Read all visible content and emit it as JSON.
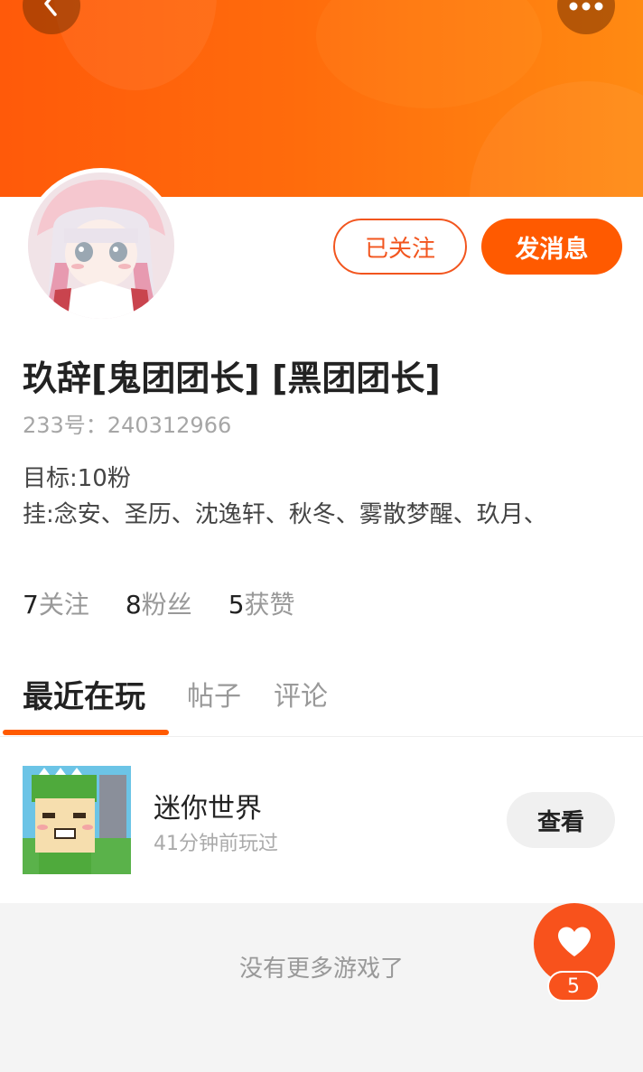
{
  "header": {
    "back_icon": "chevron-left-icon",
    "more_icon": "more-dots-icon",
    "accent_color": "#ff5a00"
  },
  "profile": {
    "avatar_icon": "avatar",
    "follow_button_label": "已关注",
    "message_button_label": "发消息",
    "username": "玖辞[鬼团团长] [黑团团长]",
    "uid_text": "233号：240312966",
    "bio_lines": [
      "目标:10粉",
      "挂:念安、圣历、沈逸轩、秋冬、雾散梦醒、玖月、"
    ]
  },
  "stats": [
    {
      "num": "7",
      "label": "关注"
    },
    {
      "num": "8",
      "label": "粉丝"
    },
    {
      "num": "5",
      "label": "获赞"
    }
  ],
  "tabs": [
    {
      "label": "最近在玩",
      "active": true
    },
    {
      "label": "帖子",
      "active": false
    },
    {
      "label": "评论",
      "active": false
    }
  ],
  "games": [
    {
      "title": "迷你世界",
      "subtitle": "41分钟前玩过",
      "button_label": "查看"
    }
  ],
  "footer": {
    "no_more_text": "没有更多游戏了"
  },
  "like": {
    "icon": "heart-icon",
    "count": "5"
  }
}
